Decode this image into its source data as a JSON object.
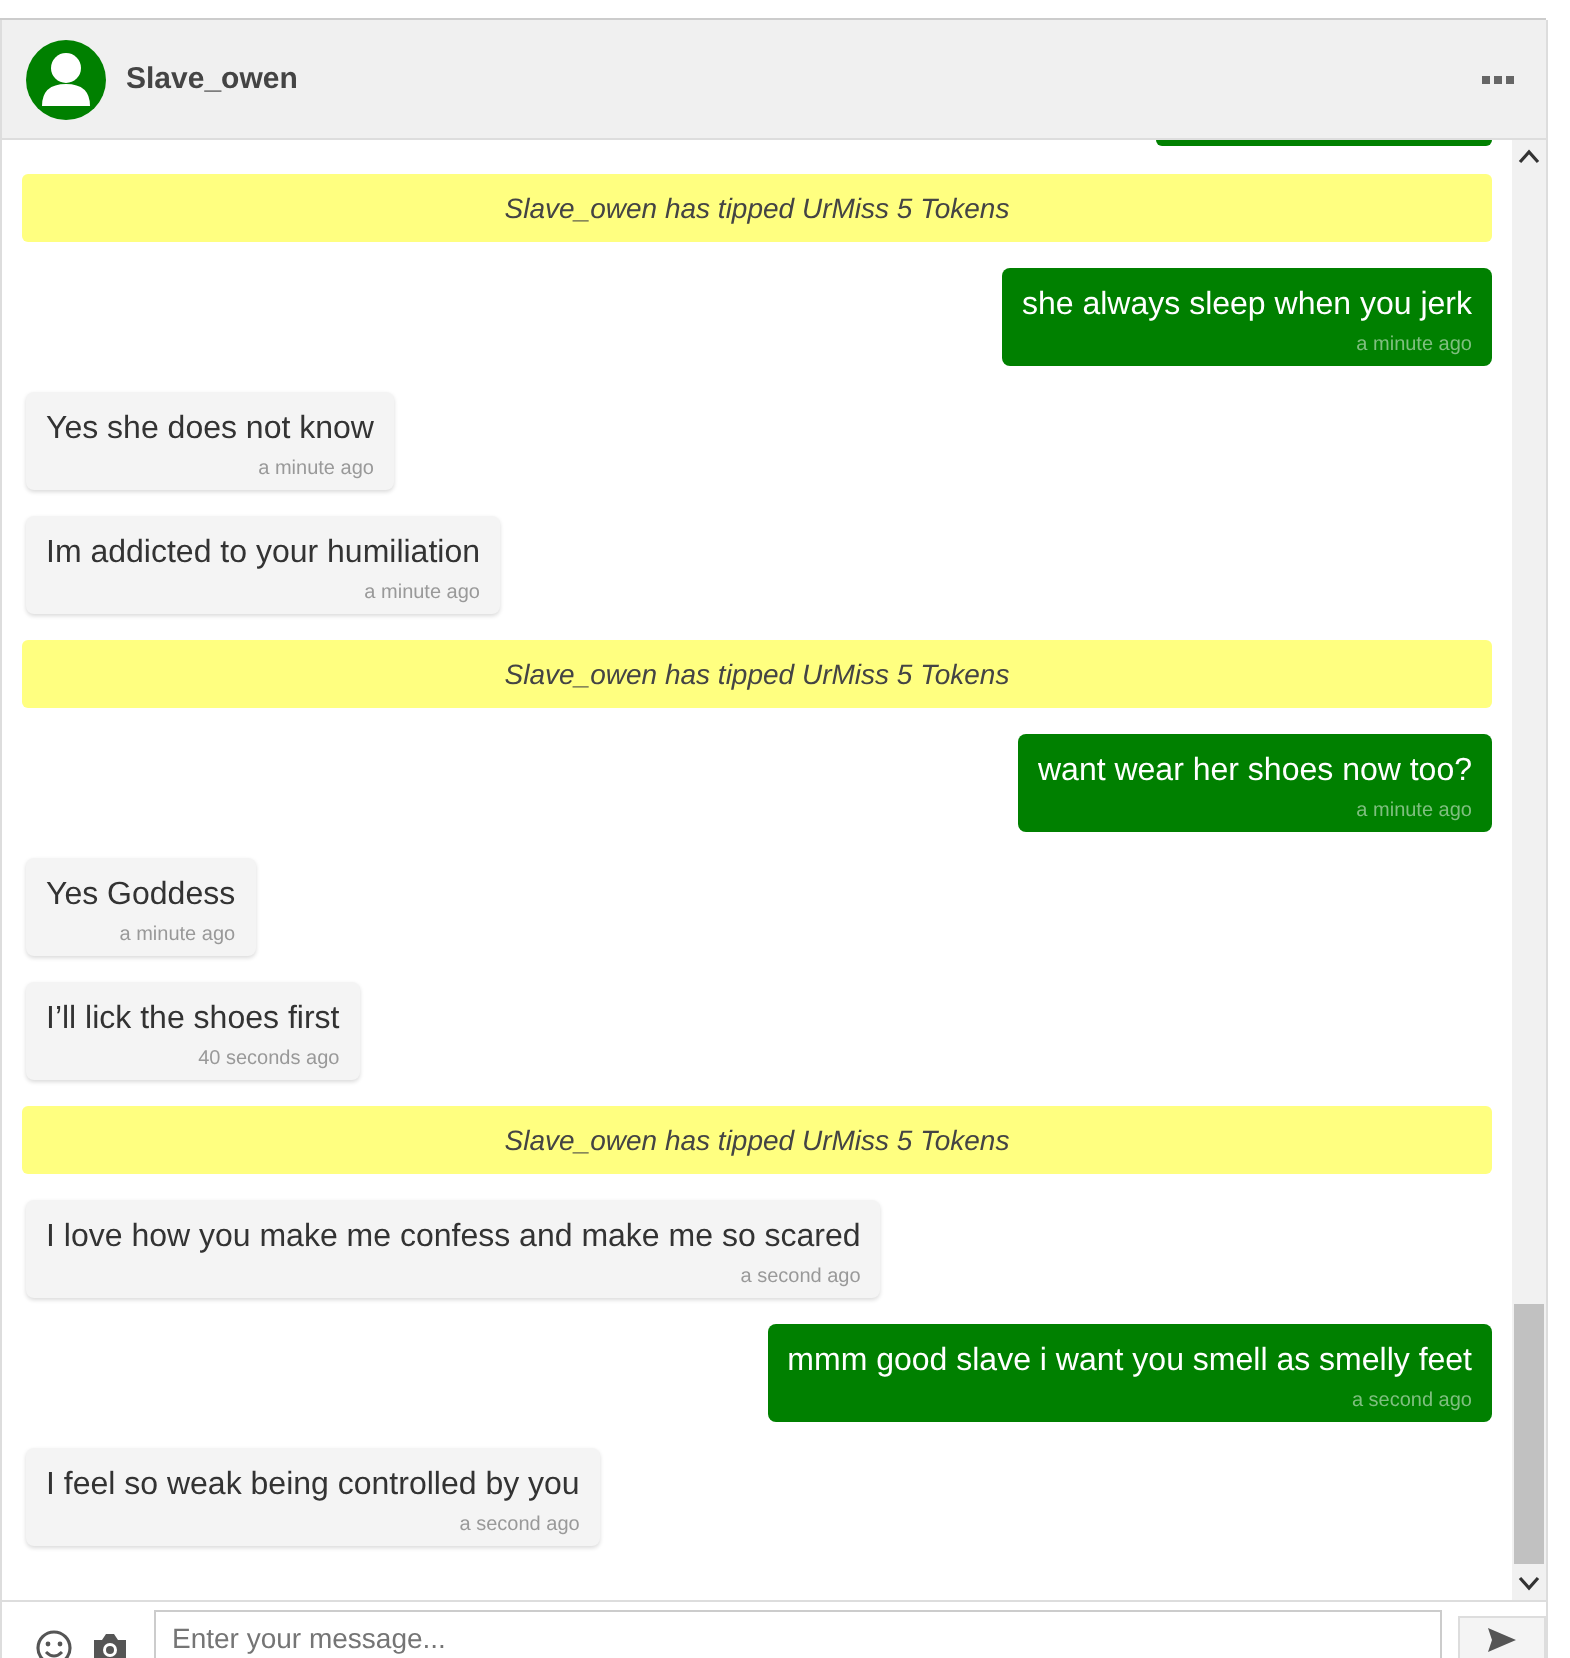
{
  "header": {
    "name": "Slave_owen"
  },
  "messages": [
    {
      "kind": "tip",
      "text": "Slave_owen has tipped UrMiss 5 Tokens"
    },
    {
      "kind": "outgoing",
      "text": "she always sleep when you jerk",
      "time": "a minute ago"
    },
    {
      "kind": "incoming",
      "text": "Yes she does not know",
      "time": "a minute ago"
    },
    {
      "kind": "incoming",
      "text": "Im addicted to your humiliation",
      "time": "a minute ago"
    },
    {
      "kind": "tip",
      "text": "Slave_owen has tipped UrMiss 5 Tokens"
    },
    {
      "kind": "outgoing",
      "text": "want wear her shoes now too?",
      "time": "a minute ago"
    },
    {
      "kind": "incoming",
      "text": "Yes Goddess",
      "time": "a minute ago"
    },
    {
      "kind": "incoming",
      "text": "I’ll lick the shoes first",
      "time": "40 seconds ago"
    },
    {
      "kind": "tip",
      "text": "Slave_owen has tipped UrMiss 5 Tokens"
    },
    {
      "kind": "incoming",
      "text": "I love how you make me confess and make me so scared",
      "time": "a second ago"
    },
    {
      "kind": "outgoing",
      "text": "mmm good slave i want you smell as smelly feet",
      "time": "a second ago"
    },
    {
      "kind": "incoming",
      "text": "I feel so weak being controlled by you",
      "time": "a second ago"
    }
  ],
  "composer": {
    "placeholder": "Enter your message..."
  }
}
